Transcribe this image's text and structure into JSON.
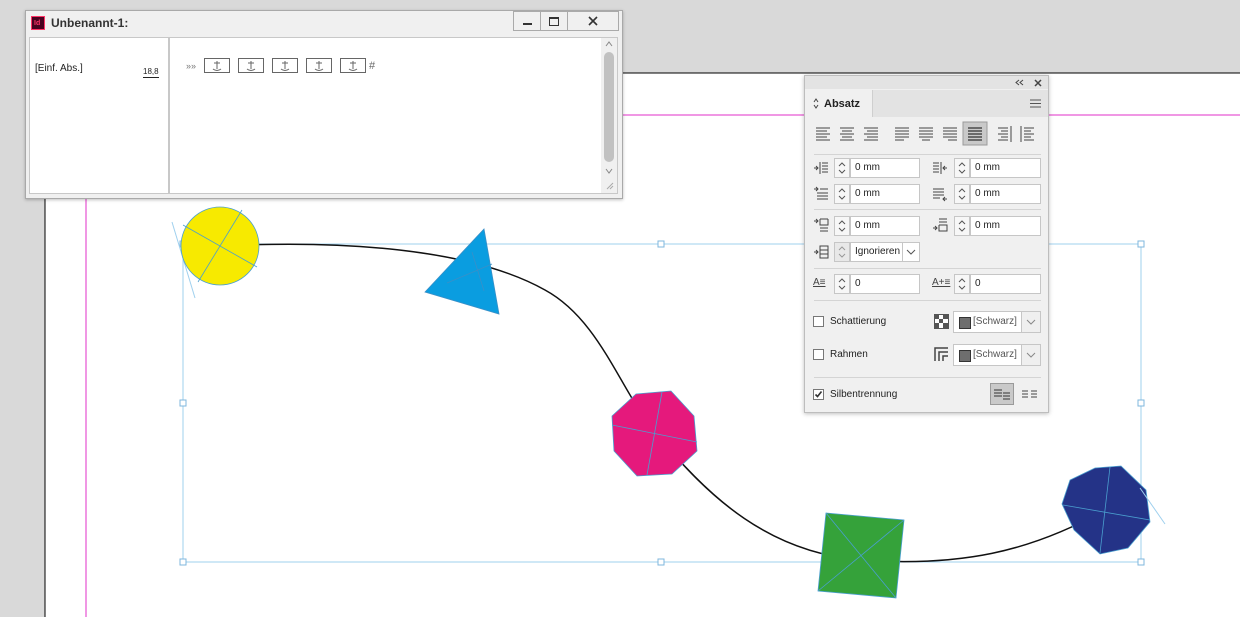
{
  "story_editor": {
    "title": "Unbenannt-1:",
    "app_icon": "Id",
    "paragraph_style": "[Einf. Abs.]",
    "depth": "18,8",
    "text_markers": [
      "»»",
      "#"
    ],
    "icons": {
      "minimize": "minimize-icon",
      "maximize": "maximize-icon",
      "close": "close-icon"
    }
  },
  "panel": {
    "tab_label": "Absatz",
    "fields": {
      "left_indent": "0 mm",
      "right_indent": "0 mm",
      "first_line_indent": "0 mm",
      "last_line_indent": "0 mm",
      "space_before": "0 mm",
      "space_after": "0 mm",
      "align_to_grid": "Ignorieren",
      "drop_cap_lines": "0",
      "drop_cap_chars": "0"
    },
    "shading_label": "Schattierung",
    "shading_color": "[Schwarz]",
    "border_label": "Rahmen",
    "border_color": "[Schwarz]",
    "hyphenation_label": "Silbentrennung",
    "hyphenation_checked": true,
    "shading_checked": false,
    "border_checked": false,
    "glyphs": {
      "drop_cap": "A≡",
      "drop_cap_chars": "A+≡"
    }
  },
  "colors": {
    "yellow_shape": "#f7ea00",
    "cyan_shape": "#0a9de0",
    "magenta_shape": "#e5197c",
    "green_shape": "#35a23a",
    "navy_shape": "#243387",
    "guide_magenta": "#e02fc8",
    "selection_blue": "#9fd0ee"
  }
}
